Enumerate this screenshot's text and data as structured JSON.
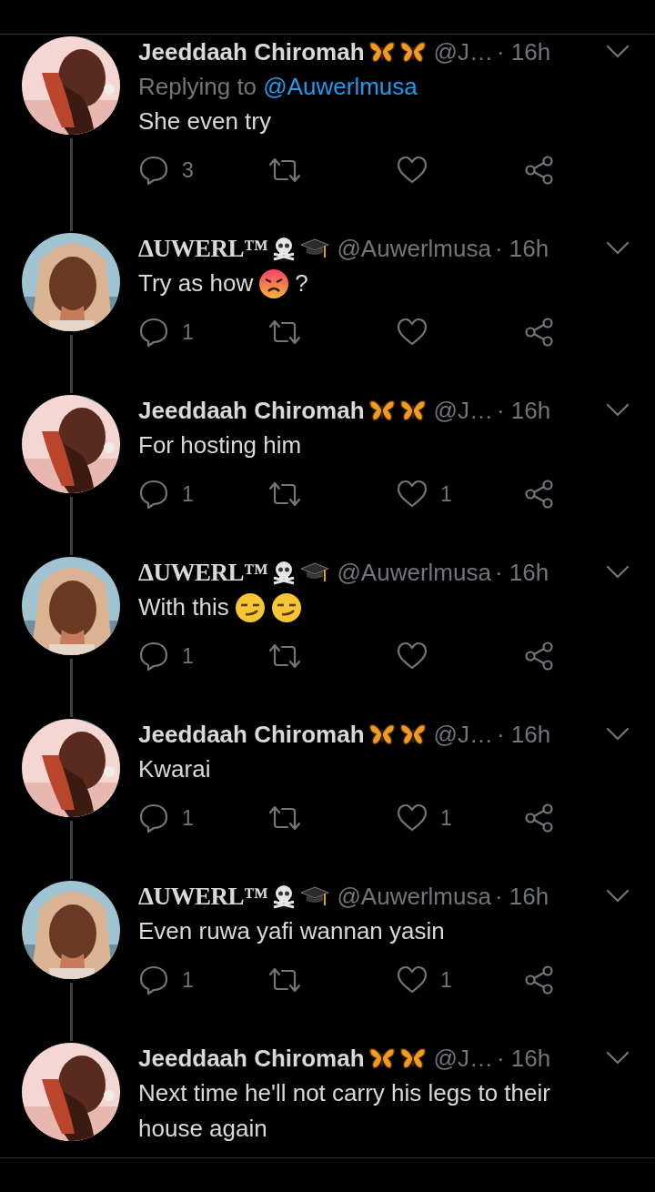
{
  "tweets": [
    {
      "name": "Jeeddaah Chiromah",
      "badges": [
        {
          "kind": "butterfly"
        },
        {
          "kind": "butterfly"
        }
      ],
      "handle": "@J…",
      "time": "· 16h",
      "replying_to": {
        "label": "Replying to",
        "handle": "@Auwerlmusa"
      },
      "body": [
        {
          "kind": "text",
          "text": "She even try"
        }
      ],
      "replies": "3"
    },
    {
      "name": "ΔUWERL™",
      "badges": [
        {
          "kind": "skull"
        },
        {
          "kind": "cap"
        }
      ],
      "handle": "@Auwerlmusa",
      "time": "· 16h",
      "body": [
        {
          "kind": "text",
          "text": "Try as how"
        },
        {
          "kind": "angry"
        },
        {
          "kind": "text",
          "text": "?"
        }
      ],
      "replies": "1"
    },
    {
      "name": "Jeeddaah Chiromah",
      "badges": [
        {
          "kind": "butterfly"
        },
        {
          "kind": "butterfly"
        }
      ],
      "handle": "@J…",
      "time": "· 16h",
      "body": [
        {
          "kind": "text",
          "text": "For hosting him"
        }
      ],
      "replies": "1",
      "likes": "1"
    },
    {
      "name": "ΔUWERL™",
      "badges": [
        {
          "kind": "skull"
        },
        {
          "kind": "cap"
        }
      ],
      "handle": "@Auwerlmusa",
      "time": "· 16h",
      "body": [
        {
          "kind": "text",
          "text": "With this"
        },
        {
          "kind": "smirk"
        },
        {
          "kind": "smirk"
        }
      ],
      "replies": "1"
    },
    {
      "name": "Jeeddaah Chiromah",
      "badges": [
        {
          "kind": "butterfly"
        },
        {
          "kind": "butterfly"
        }
      ],
      "handle": "@J…",
      "time": "· 16h",
      "body": [
        {
          "kind": "text",
          "text": "Kwarai"
        }
      ],
      "replies": "1",
      "likes": "1"
    },
    {
      "name": "ΔUWERL™",
      "badges": [
        {
          "kind": "skull"
        },
        {
          "kind": "cap"
        }
      ],
      "handle": "@Auwerlmusa",
      "time": "· 16h",
      "body": [
        {
          "kind": "text",
          "text": "Even ruwa yafi wannan yasin"
        }
      ],
      "replies": "1",
      "likes": "1"
    },
    {
      "name": "Jeeddaah Chiromah",
      "badges": [
        {
          "kind": "butterfly"
        },
        {
          "kind": "butterfly"
        }
      ],
      "handle": "@J…",
      "time": "· 16h",
      "body": [
        {
          "kind": "text",
          "text": "Next time he'll not carry his legs to their house again"
        }
      ]
    }
  ]
}
